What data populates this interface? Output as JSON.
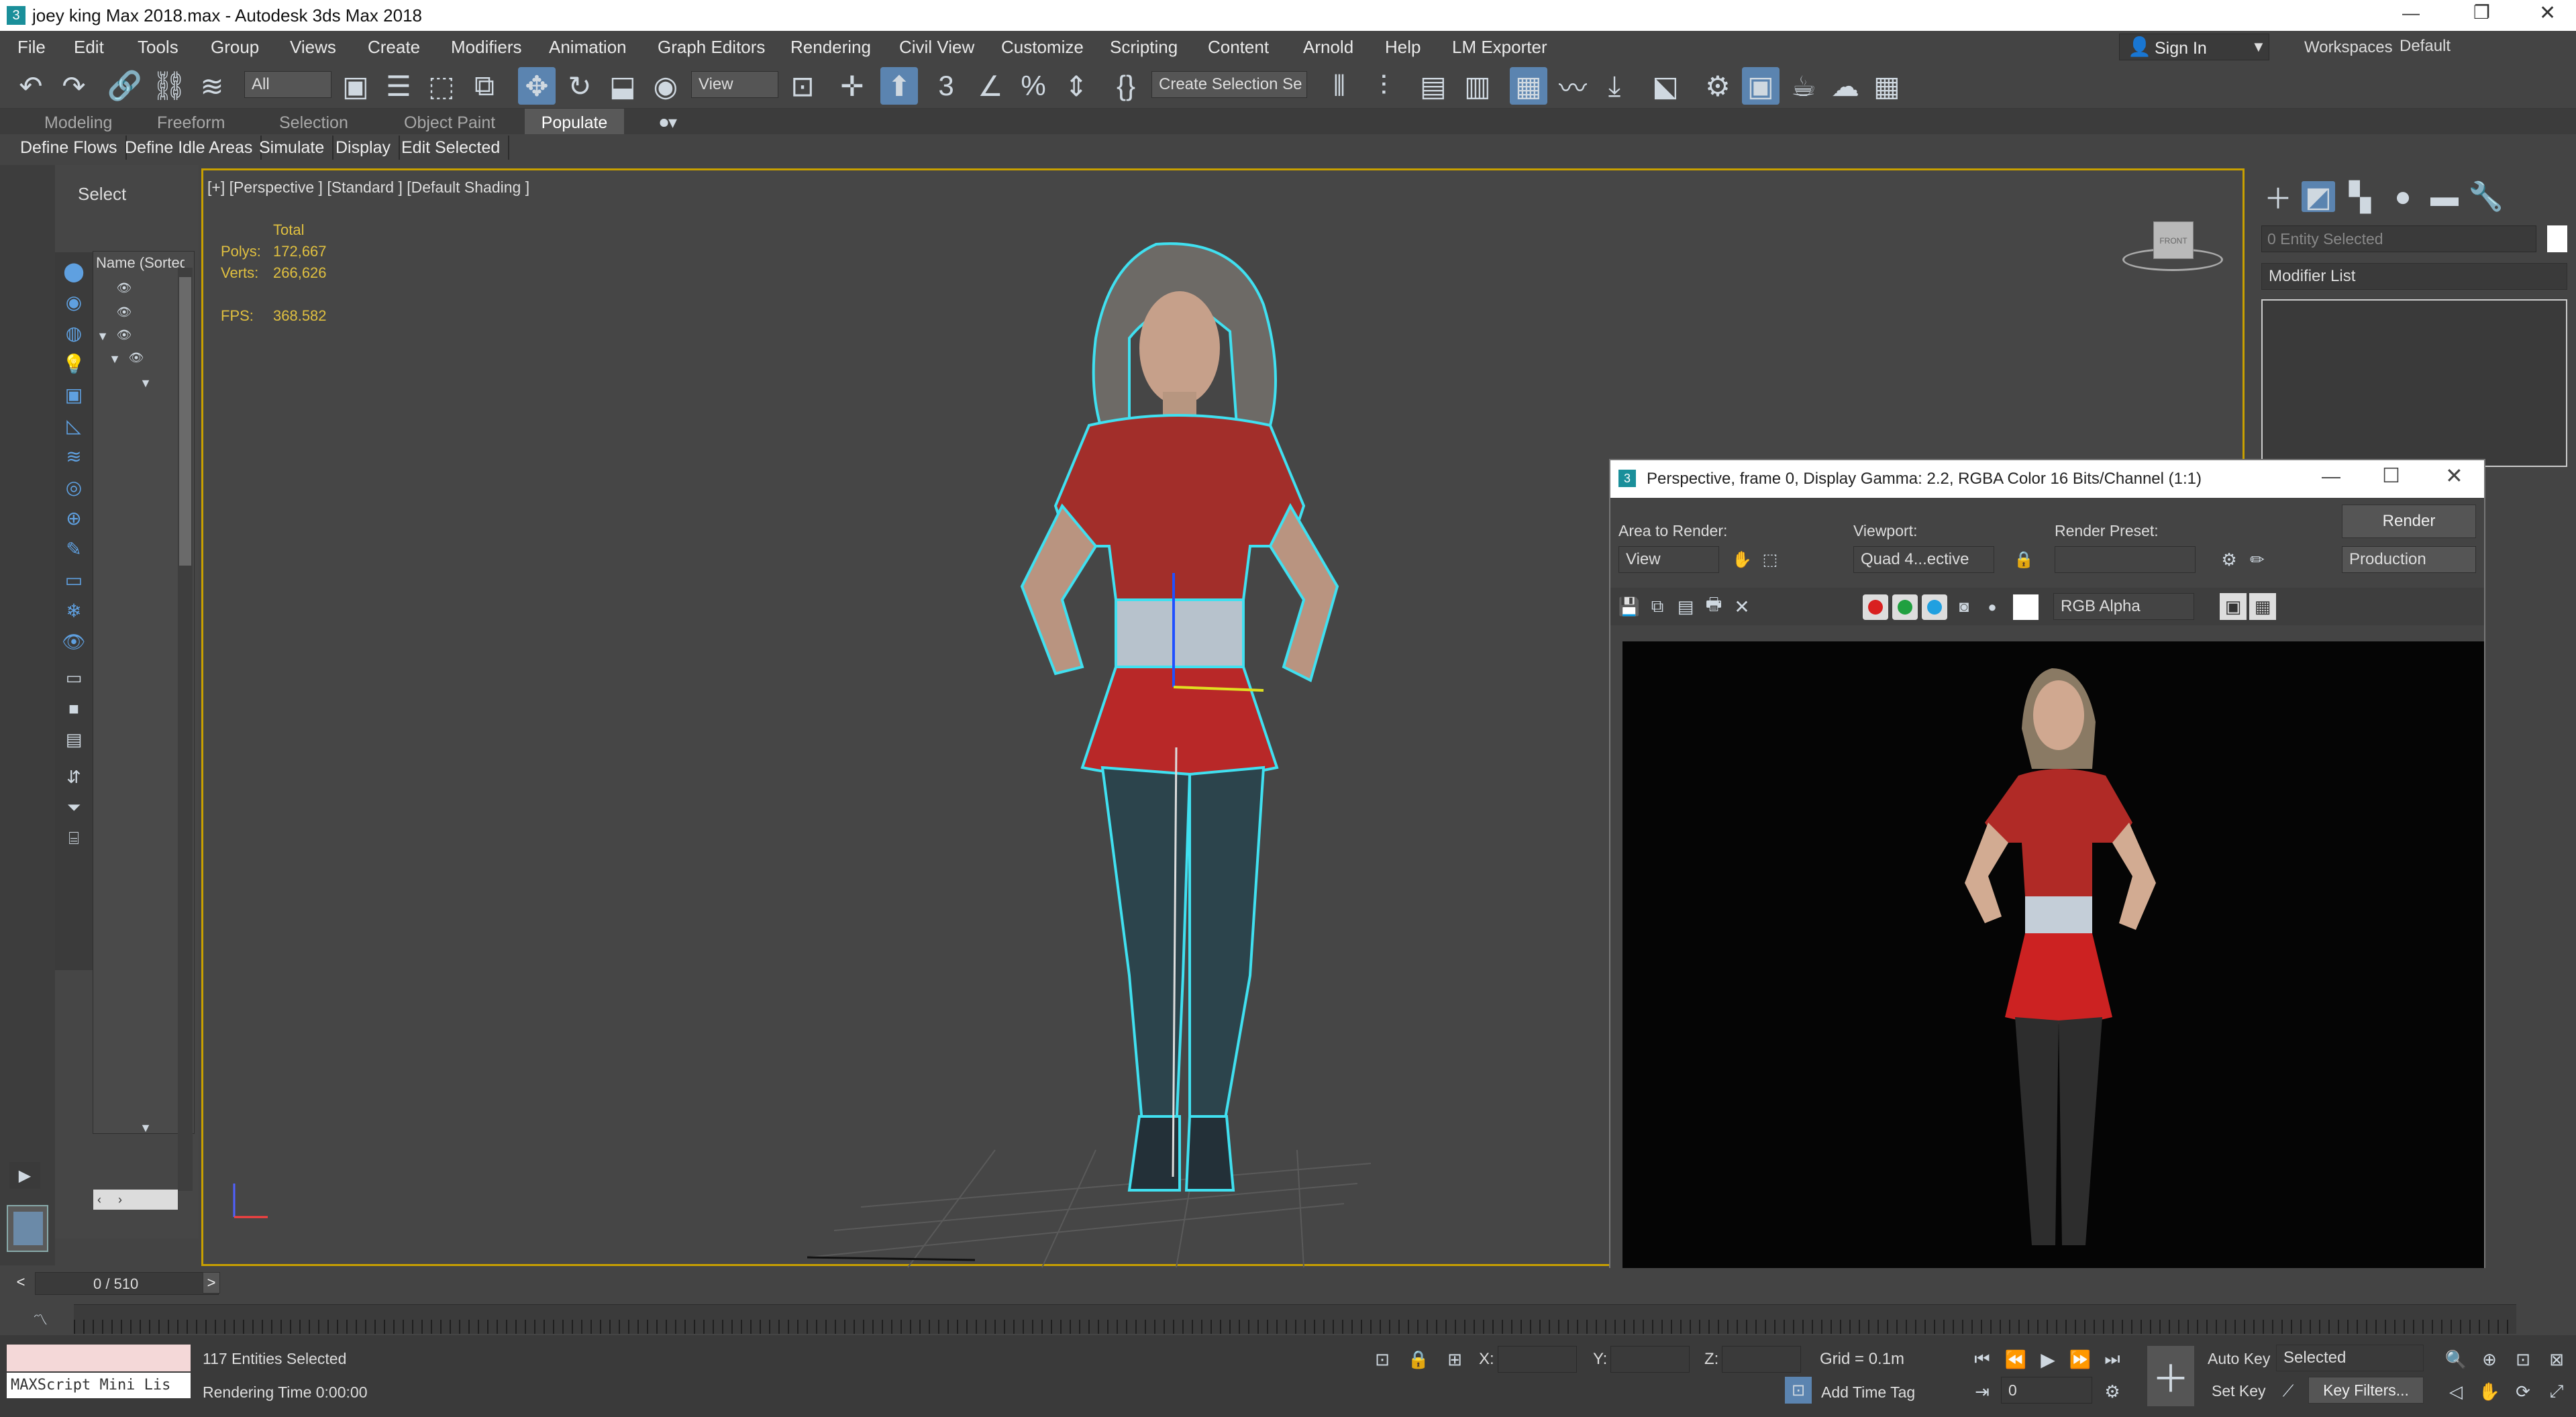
{
  "window": {
    "title": "joey king Max 2018.max - Autodesk 3ds Max 2018",
    "min": "—",
    "max": "❐",
    "close": "✕"
  },
  "menu": [
    "File",
    "Edit",
    "Tools",
    "Group",
    "Views",
    "Create",
    "Modifiers",
    "Animation",
    "Graph Editors",
    "Rendering",
    "Civil View",
    "Customize",
    "Scripting",
    "Content",
    "Arnold",
    "Help",
    "LM Exporter"
  ],
  "account": {
    "signin": "Sign In",
    "workspaces_label": "Workspaces:",
    "workspace": "Default"
  },
  "toolbar": {
    "filter": "All",
    "ref_coord": "View",
    "selection_set": "Create Selection Se"
  },
  "ribbon": {
    "tabs": [
      "Modeling",
      "Freeform",
      "Selection",
      "Object Paint",
      "Populate"
    ],
    "active": "Populate"
  },
  "subribbon": [
    "Define Flows",
    "Define Idle Areas",
    "Simulate",
    "Display",
    "Edit Selected"
  ],
  "explorer": {
    "select": "Select",
    "column": "Name (Sorted A"
  },
  "viewport": {
    "label": "[+] [Perspective ] [Standard ] [Default Shading ]",
    "stats_total": "Total",
    "polys_label": "Polys:",
    "polys": "172,667",
    "verts_label": "Verts:",
    "verts": "266,626",
    "fps_label": "FPS:",
    "fps": "368.582",
    "viewcube": "FRONT"
  },
  "cmdpanel": {
    "entity": "0 Entity Selected",
    "modifier_list": "Modifier List"
  },
  "framewin": {
    "title": "Perspective, frame 0, Display Gamma: 2.2, RGBA Color 16 Bits/Channel (1:1)",
    "area_label": "Area to Render:",
    "area_value": "View",
    "viewport_label": "Viewport:",
    "viewport_value": "Quad 4...ective",
    "preset_label": "Render Preset:",
    "preset_value": "",
    "render_btn": "Render",
    "production": "Production",
    "channel": "RGB Alpha",
    "colors": {
      "red": "#d92020",
      "green": "#20a040",
      "blue": "#20a0e0"
    }
  },
  "timeline": {
    "frame": "0 / 510",
    "prev": "<",
    "next": ">"
  },
  "status": {
    "maxscript": "MAXScript Mini Lis",
    "entities": "117 Entities Selected",
    "render_time": "Rendering Time  0:00:00",
    "x_label": "X:",
    "y_label": "Y:",
    "z_label": "Z:",
    "grid": "Grid = 0.1m",
    "add_time_tag": "Add Time Tag",
    "auto_key": "Auto Key",
    "set_key": "Set Key",
    "selected": "Selected",
    "key_filters": "Key Filters...",
    "frame_field": "0"
  }
}
